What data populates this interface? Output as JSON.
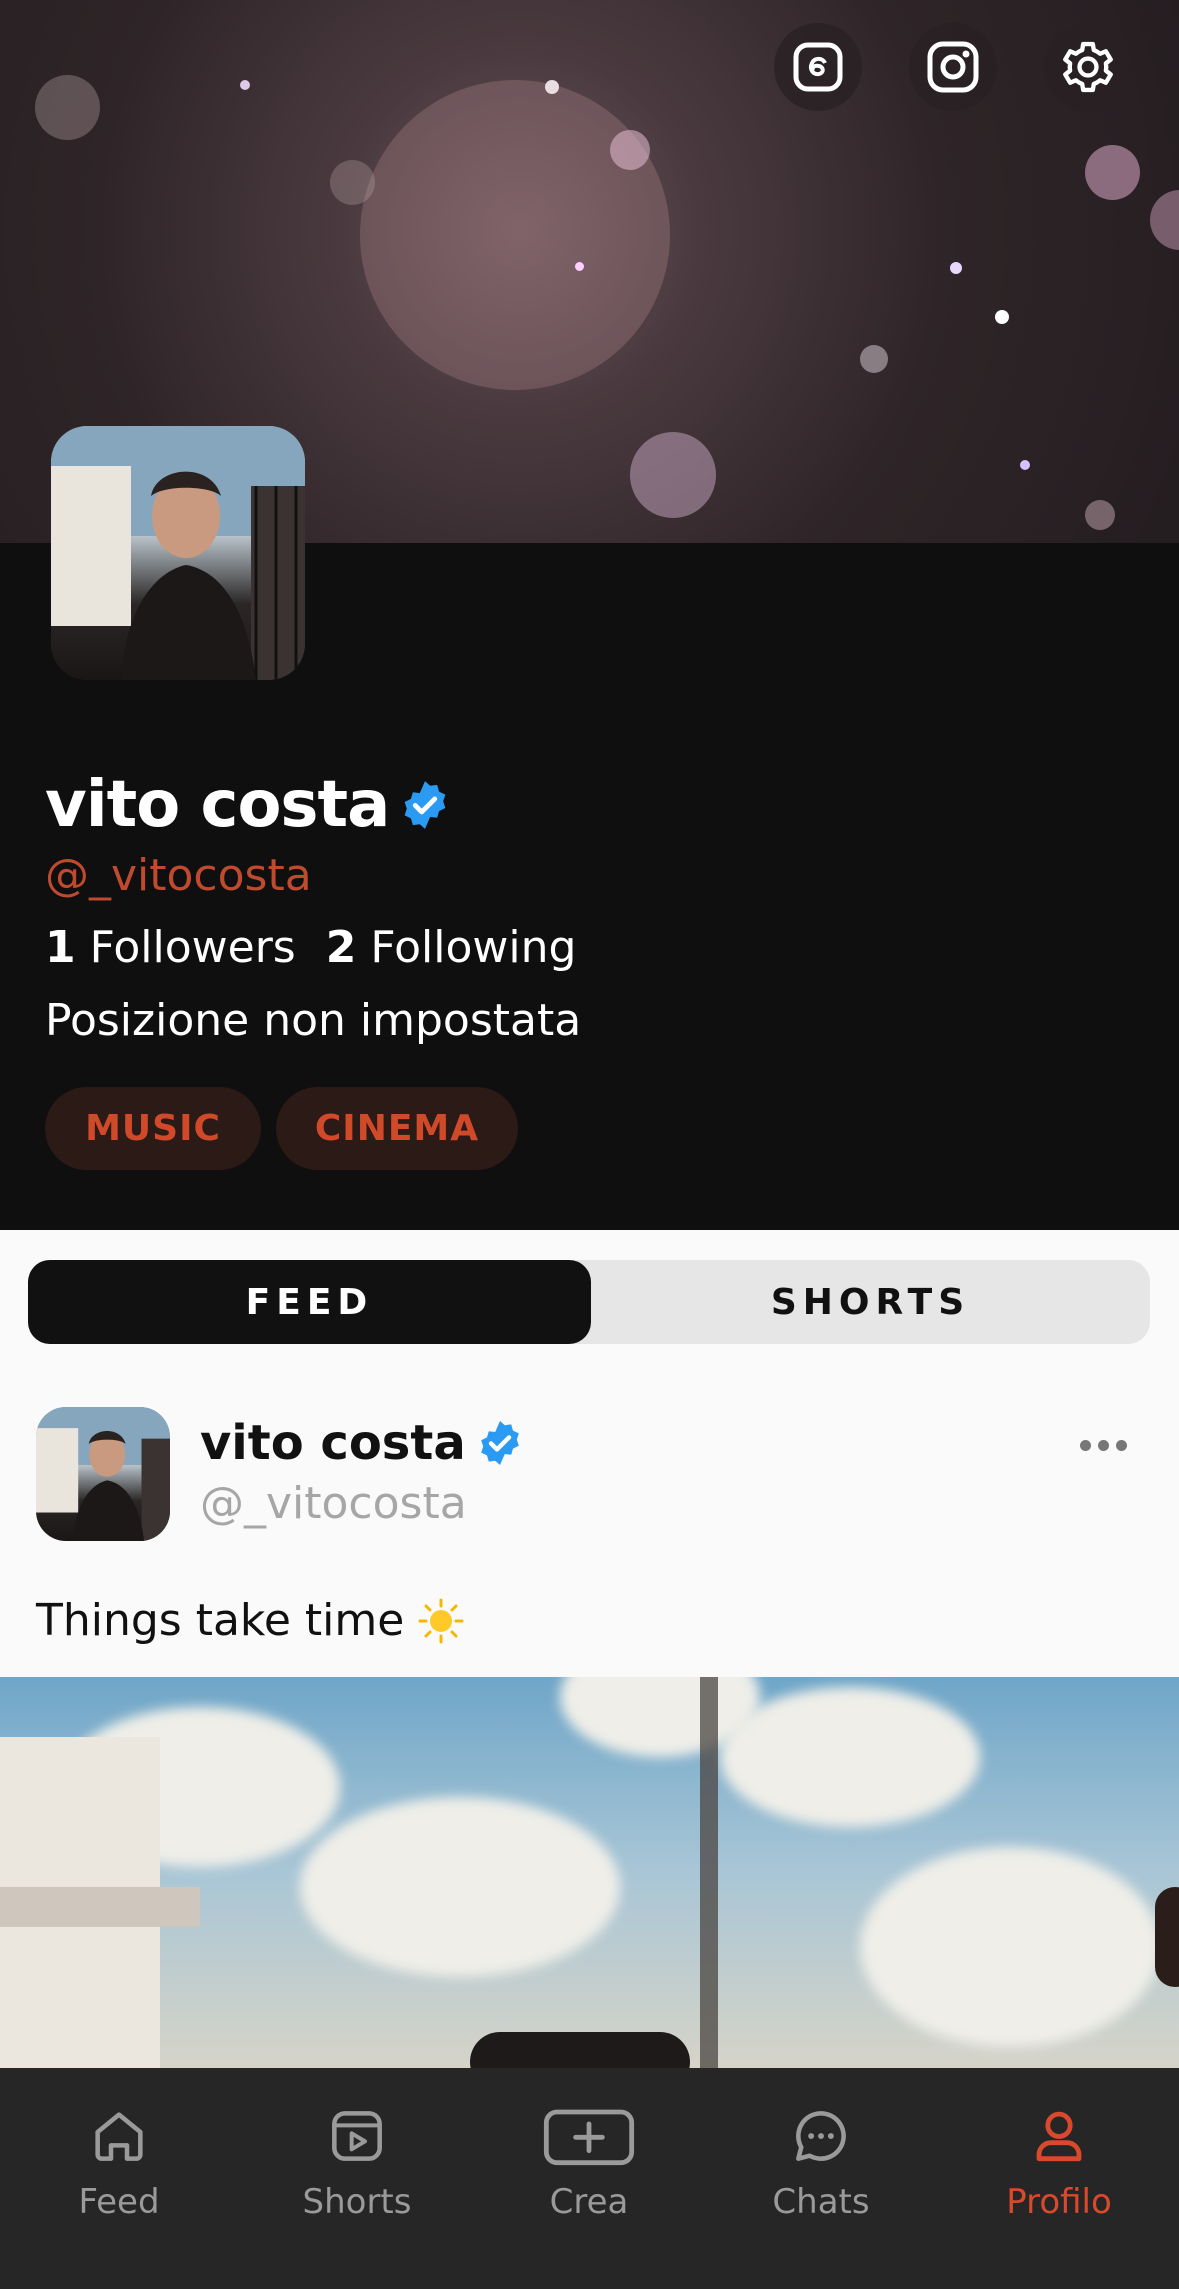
{
  "profile": {
    "name": "vito costa",
    "handle": "@_vitocosta",
    "followers_count": "1",
    "followers_label": "Followers",
    "following_count": "2",
    "following_label": "Following",
    "location": "Posizione non impostata",
    "interests": [
      "MUSIC",
      "CINEMA"
    ]
  },
  "tabs": {
    "feed": "FEED",
    "shorts": "SHORTS",
    "active": "FEED"
  },
  "post": {
    "author_name": "vito costa",
    "author_handle": "@_vitocosta",
    "text": "Things take time"
  },
  "nav": {
    "items": [
      {
        "label": "Feed",
        "icon": "home-icon"
      },
      {
        "label": "Shorts",
        "icon": "play-icon"
      },
      {
        "label": "Crea",
        "icon": "add-icon"
      },
      {
        "label": "Chats",
        "icon": "chat-icon"
      },
      {
        "label": "Profilo",
        "icon": "user-icon"
      }
    ],
    "active": "Profilo"
  },
  "colors": {
    "accent": "#d9492b",
    "verified": "#2b9af3",
    "dark_bg": "#0f0f0f",
    "chip_bg": "#2b1a16"
  }
}
